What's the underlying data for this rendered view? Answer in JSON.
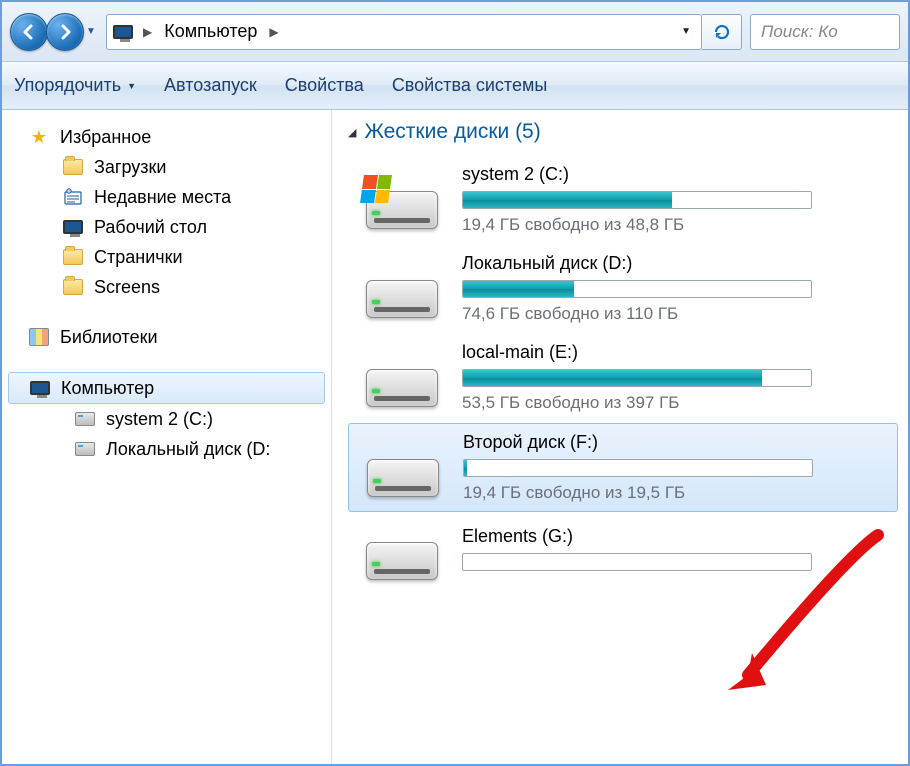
{
  "addressbar": {
    "location": "Компьютер",
    "search_placeholder": "Поиск: Ко"
  },
  "toolbar": {
    "organize": "Упорядочить",
    "autorun": "Автозапуск",
    "properties": "Свойства",
    "system_properties": "Свойства системы"
  },
  "sidebar": {
    "favorites": {
      "label": "Избранное",
      "items": [
        {
          "label": "Загрузки"
        },
        {
          "label": "Недавние места"
        },
        {
          "label": "Рабочий стол"
        },
        {
          "label": "Странички"
        },
        {
          "label": "Screens"
        }
      ]
    },
    "libraries": {
      "label": "Библиотеки"
    },
    "computer": {
      "label": "Компьютер",
      "items": [
        {
          "label": "system 2 (C:)"
        },
        {
          "label": "Локальный диск (D:"
        }
      ]
    }
  },
  "main": {
    "section_title": "Жесткие диски (5)",
    "drives": [
      {
        "name": "system 2 (C:)",
        "free": "19,4 ГБ свободно из 48,8 ГБ",
        "fill_pct": 60,
        "system": true
      },
      {
        "name": "Локальный диск (D:)",
        "free": "74,6 ГБ свободно из 110 ГБ",
        "fill_pct": 32
      },
      {
        "name": "local-main (E:)",
        "free": "53,5 ГБ свободно из 397 ГБ",
        "fill_pct": 86
      },
      {
        "name": "Второй диск (F:)",
        "free": "19,4 ГБ свободно из 19,5 ГБ",
        "fill_pct": 1,
        "selected": true
      },
      {
        "name": "Elements (G:)",
        "free": "",
        "fill_pct": 0
      }
    ]
  }
}
